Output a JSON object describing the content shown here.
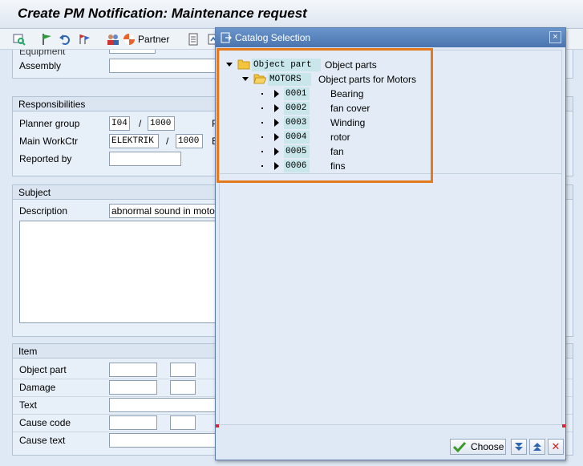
{
  "window": {
    "title": "Create PM Notification: Maintenance request"
  },
  "toolbar": {
    "partner_label": "Partner"
  },
  "form": {
    "top_partial_label": "Equipment",
    "assembly_label": "Assembly",
    "responsibilities": {
      "title": "Responsibilities",
      "planner_group_label": "Planner group",
      "planner_group_value": "I04",
      "planner_group_plant": "1000",
      "main_workctr_label": "Main WorkCtr",
      "main_workctr_value": "ELEKTRIK",
      "main_workctr_plant": "1000",
      "reported_by_label": "Reported by",
      "side_letter_1": "P",
      "side_letter_2": "E"
    },
    "subject": {
      "title": "Subject",
      "description_label": "Description",
      "description_value": "abnormal sound in motor"
    },
    "item": {
      "title": "Item",
      "object_part_label": "Object part",
      "damage_label": "Damage",
      "text_label": "Text",
      "cause_code_label": "Cause code",
      "cause_text_label": "Cause text"
    },
    "separator": "/"
  },
  "dialog": {
    "title": "Catalog Selection",
    "close_label": "×",
    "tree": {
      "root": {
        "key": "Object part",
        "desc": "Object parts"
      },
      "group": {
        "key": "MOTORS",
        "desc": "Object parts for Motors"
      },
      "items": [
        {
          "key": "0001",
          "desc": "Bearing"
        },
        {
          "key": "0002",
          "desc": "fan cover"
        },
        {
          "key": "0003",
          "desc": "Winding"
        },
        {
          "key": "0004",
          "desc": "rotor"
        },
        {
          "key": "0005",
          "desc": "fan"
        },
        {
          "key": "0006",
          "desc": "fins"
        }
      ]
    },
    "choose_label": "Choose",
    "cancel_label": "✕"
  },
  "colors": {
    "highlight": "#e47a1e",
    "dialog_title": "#4a74ae",
    "key_bg": "#c9e7ea"
  }
}
